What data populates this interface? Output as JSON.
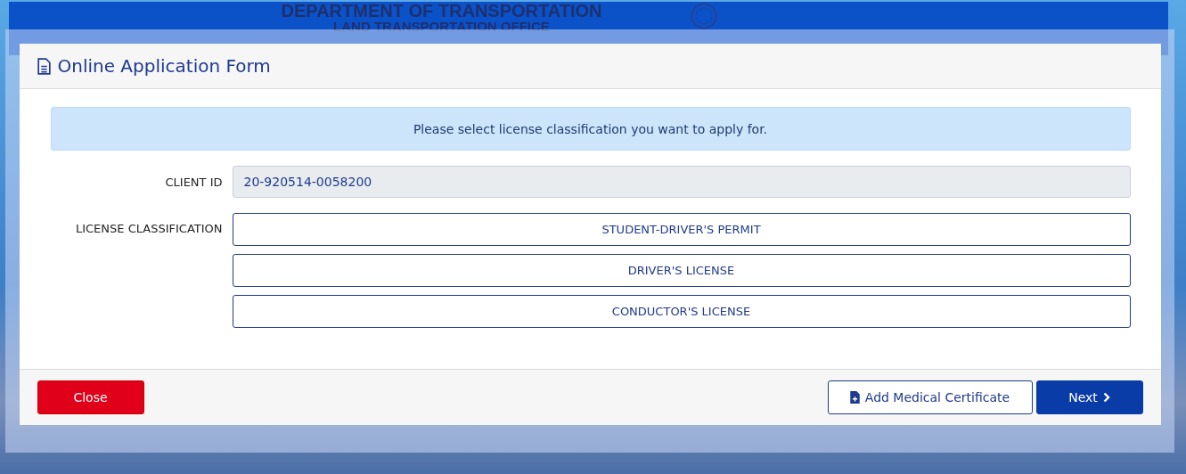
{
  "background": {
    "agency": "DEPARTMENT OF TRANSPORTATION",
    "office": "LAND TRANSPORTATION OFFICE"
  },
  "dialog": {
    "title": "Online Application Form",
    "notice": "Please select license classification you want to apply for.",
    "client_id": {
      "label": "CLIENT ID",
      "value": "20-920514-0058200"
    },
    "license_classification": {
      "label": "LICENSE CLASSIFICATION",
      "options": [
        "STUDENT-DRIVER'S PERMIT",
        "DRIVER'S LICENSE",
        "CONDUCTOR'S LICENSE"
      ]
    },
    "footer_buttons": [
      {
        "label": "Close",
        "kind": "danger"
      },
      {
        "label": "Add Medical Certificate",
        "kind": "outline"
      },
      {
        "label": "Next",
        "kind": "primary"
      }
    ]
  }
}
